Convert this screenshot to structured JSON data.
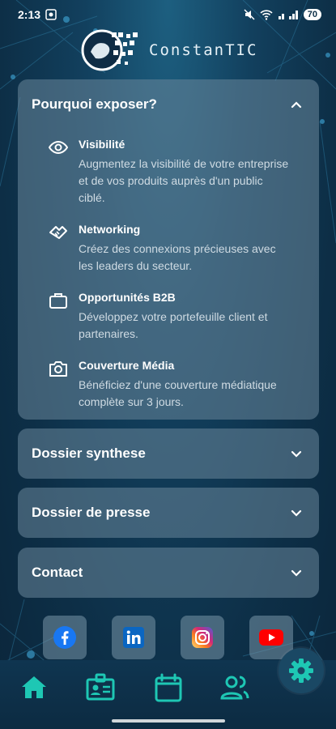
{
  "status_bar": {
    "time": "2:13",
    "battery": "70"
  },
  "brand": {
    "name": "ConstanTIC"
  },
  "accordion": [
    {
      "title": "Pourquoi exposer?",
      "expanded": true,
      "items": [
        {
          "icon": "eye-icon",
          "title": "Visibilité",
          "description": "Augmentez la visibilité de votre entreprise et de vos produits auprès d'un public ciblé."
        },
        {
          "icon": "handshake-icon",
          "title": "Networking",
          "description": "Créez des connexions précieuses avec les leaders du secteur."
        },
        {
          "icon": "briefcase-icon",
          "title": "Opportunités B2B",
          "description": "Développez votre portefeuille client et partenaires."
        },
        {
          "icon": "camera-icon",
          "title": "Couverture Média",
          "description": "Bénéficiez d'une couverture médiatique complète sur 3 jours."
        }
      ]
    },
    {
      "title": "Dossier synthese",
      "expanded": false
    },
    {
      "title": "Dossier de presse",
      "expanded": false
    },
    {
      "title": "Contact",
      "expanded": false
    }
  ],
  "social": [
    "facebook-icon",
    "linkedin-icon",
    "instagram-icon",
    "youtube-icon"
  ],
  "nav": [
    "home-icon",
    "badge-icon",
    "calendar-icon",
    "people-icon"
  ],
  "colors": {
    "accent": "#1ec7b4",
    "card": "#5d7f94",
    "background": "#0d2f47"
  }
}
